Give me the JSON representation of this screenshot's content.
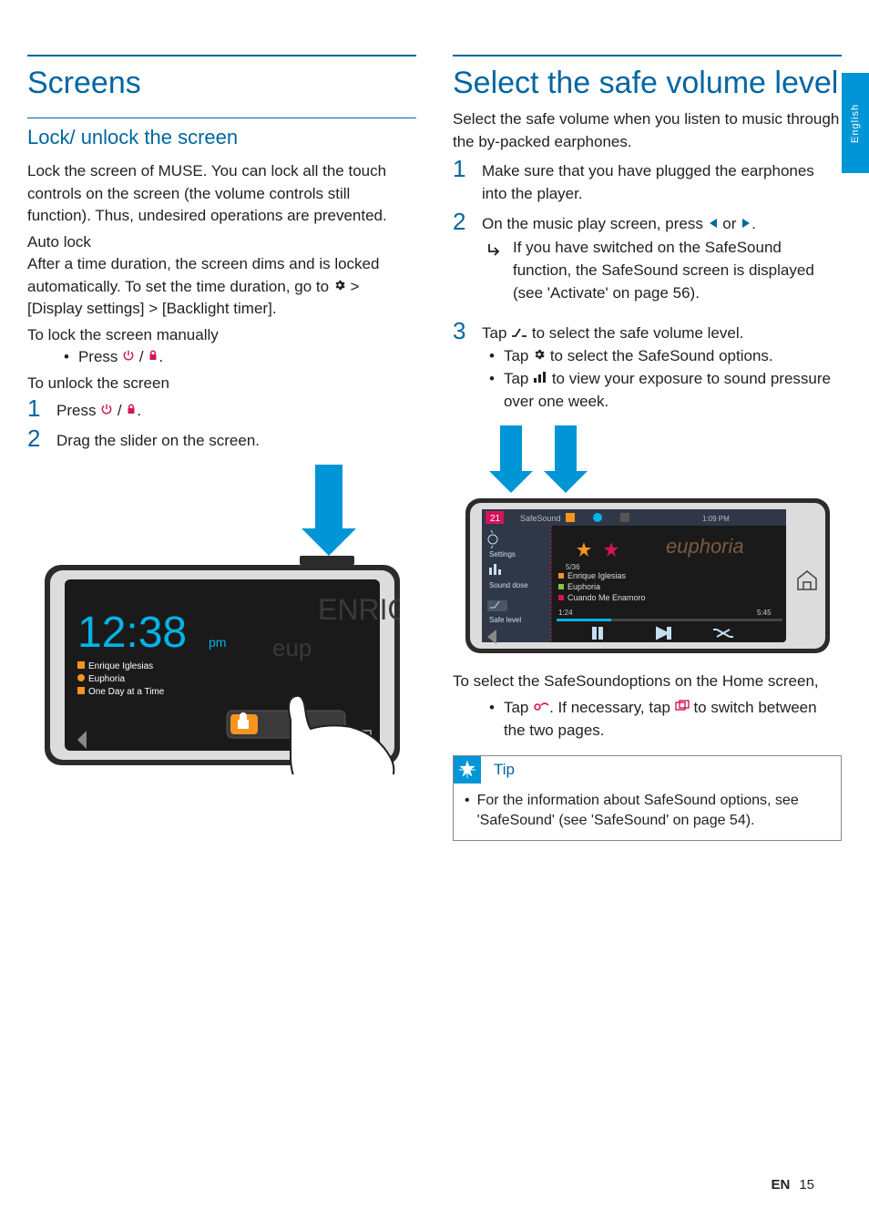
{
  "sideTab": "English",
  "left": {
    "h1": "Screens",
    "h2": "Lock/ unlock the screen",
    "p1a": "Lock the screen of ",
    "p1b": "MUSE",
    "p1c": ".  You can lock all the touch controls on the screen (the volume controls still function). Thus, undesired operations are prevented.",
    "sub1": "Auto lock",
    "p2a": "After a time duration, the screen dims and is locked automatically. To set the time duration, go to ",
    "p2b": " > ",
    "p2c": "[Display settings]",
    "p2d": " > ",
    "p2e": "[Backlight timer]",
    "p2f": ".",
    "sub2": "To lock the screen manually",
    "lock_b1a": "Press ",
    "lock_b1b": " / ",
    "lock_b1c": ".",
    "sub3": "To unlock the screen",
    "s1a": "Press ",
    "s1b": " / ",
    "s1c": ".",
    "s2": "Drag the slider on the screen.",
    "device": {
      "time": "12:38",
      "ampm": "pm",
      "line1": "Enrique Iglesias",
      "line2": "Euphoria",
      "line3": "One Day at a Time",
      "bgArtist": "ENRIQUE",
      "bgAlbum": "eup"
    }
  },
  "right": {
    "h1": "Select the safe volume level",
    "p1": "Select the safe volume when you listen to music through the by-packed earphones.",
    "s1": "Make sure that you have plugged the earphones into the player.",
    "s2a": "On the music play screen, press ",
    "s2b": " or ",
    "s2c": ".",
    "s2_sub": "If you have switched on the SafeSound function, the SafeSound screen is displayed (see 'Activate' on page 56).",
    "s3a": "Tap ",
    "s3b": " to select the safe volume level.",
    "s3_b1a": "Tap ",
    "s3_b1b": " to select the ",
    "s3_b1c": "SafeSound",
    "s3_b1d": " options.",
    "s3_b2a": "Tap ",
    "s3_b2b": " to view your exposure to sound pressure over one week.",
    "device": {
      "badge": "21",
      "title": "SafeSound",
      "time": "1:09 PM",
      "m1a": "Settings",
      "m2a": "Sound dose",
      "m3a": "Safe level",
      "track_no": "5/36",
      "artist": "Enrique Iglesias",
      "album": "Euphoria",
      "song": "Cuando Me Enamoro",
      "elapsed": "1:24",
      "total": "5:45",
      "bgAlbum": "euphoria"
    },
    "post1": "To select the SafeSoundoptions on the Home screen,",
    "post_b1a": "Tap ",
    "post_b1b": ". If necessary, tap ",
    "post_b1c": " to switch between the two pages.",
    "tipLabel": "Tip",
    "tipBody": "For the information about SafeSound options, see 'SafeSound' (see 'SafeSound' on page 54)."
  },
  "footer": {
    "lang": "EN",
    "page": "15"
  }
}
